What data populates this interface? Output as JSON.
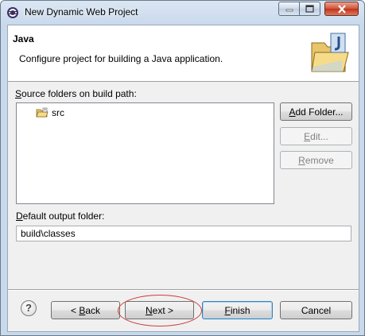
{
  "window": {
    "title": "New Dynamic Web Project",
    "icon": "eclipse-icon",
    "controls": [
      "minimize-icon",
      "maximize-icon",
      "close-icon"
    ]
  },
  "banner": {
    "title": "Java",
    "description": "Configure project for building a Java application.",
    "icon": "java-folder-icon"
  },
  "source_folders": {
    "label_underlined": "S",
    "label_rest": "ource folders on build path:",
    "items": [
      {
        "label": "src",
        "icon": "source-folder-icon"
      }
    ]
  },
  "side_buttons": {
    "add_folder_u": "A",
    "add_folder_rest": "dd Folder...",
    "edit_u": "E",
    "edit_rest": "dit...",
    "remove_u": "R",
    "remove_rest": "emove"
  },
  "output_folder": {
    "label_underlined": "D",
    "label_rest": "efault output folder:",
    "value": "build\\classes"
  },
  "footer": {
    "help_icon": "help-icon",
    "back_pre": "< ",
    "back_u": "B",
    "back_rest": "ack",
    "next_u": "N",
    "next_rest": "ext >",
    "finish_u": "F",
    "finish_rest": "inish",
    "cancel": "Cancel"
  },
  "colors": {
    "annotation": "#d23b3b",
    "title_bar": "#c9d9ec",
    "dialog_bg": "#f0f0f0"
  }
}
